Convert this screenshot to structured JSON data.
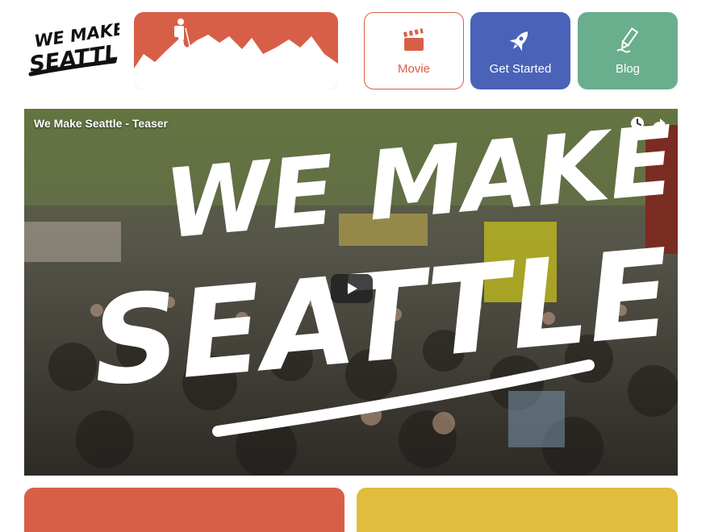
{
  "header": {
    "logo_text_line1": "WE MAKE",
    "logo_text_line2": "SEATTLE"
  },
  "nav": [
    {
      "label": "Movie",
      "icon": "clapperboard-icon"
    },
    {
      "label": "Get Started",
      "icon": "rocket-icon"
    },
    {
      "label": "Blog",
      "icon": "pencil-icon"
    }
  ],
  "video": {
    "title": "We Make Seattle - Teaser",
    "overlay_line1": "WE MAKE",
    "overlay_line2": "SEATTLE"
  },
  "colors": {
    "red": "#d85f47",
    "blue": "#4a62b8",
    "green": "#6aae8e",
    "yellow": "#e0bd3e"
  }
}
